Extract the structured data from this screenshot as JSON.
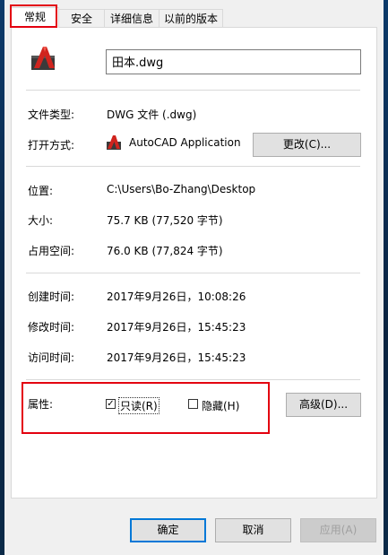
{
  "tabs": [
    {
      "label": "常规"
    },
    {
      "label": "安全"
    },
    {
      "label": "详细信息"
    },
    {
      "label": "以前的版本"
    }
  ],
  "file": {
    "name": "田本.dwg",
    "icon": "autocad-file-icon"
  },
  "type_row": {
    "label": "文件类型:",
    "value": "DWG 文件 (.dwg)"
  },
  "open_row": {
    "label": "打开方式:",
    "app": "AutoCAD Application",
    "change_button": "更改(C)..."
  },
  "location_row": {
    "label": "位置:",
    "value": "C:\\Users\\Bo-Zhang\\Desktop"
  },
  "size_row": {
    "label": "大小:",
    "value": "75.7 KB (77,520 字节)"
  },
  "disk_row": {
    "label": "占用空间:",
    "value": "76.0 KB (77,824 字节)"
  },
  "created_row": {
    "label": "创建时间:",
    "value": "2017年9月26日，10:08:26"
  },
  "modified_row": {
    "label": "修改时间:",
    "value": "2017年9月26日，15:45:23"
  },
  "accessed_row": {
    "label": "访问时间:",
    "value": "2017年9月26日，15:45:23"
  },
  "attributes": {
    "label": "属性:",
    "readonly_label": "只读(R)",
    "readonly_checked": true,
    "hidden_label": "隐藏(H)",
    "hidden_checked": false,
    "advanced_button": "高级(D)..."
  },
  "footer": {
    "ok": "确定",
    "cancel": "取消",
    "apply": "应用(A)"
  },
  "colors": {
    "highlight": "#e3000f",
    "accent": "#0078d7"
  }
}
